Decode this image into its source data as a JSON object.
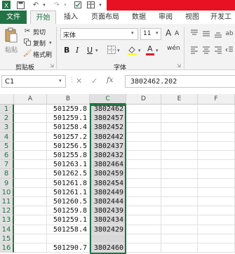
{
  "ribbon_tabs": {
    "file": "文件",
    "home": "开始",
    "insert": "插入",
    "page_layout": "页面布局",
    "data": "数据",
    "review": "审阅",
    "view": "视图",
    "developer": "开发工"
  },
  "clipboard": {
    "paste": "粘贴",
    "cut": "剪切",
    "copy": "复制",
    "format_painter": "格式刷",
    "group_label": "剪贴板"
  },
  "font": {
    "name": "宋体",
    "size": "11",
    "grow": "A",
    "shrink": "A",
    "bold": "B",
    "italic": "I",
    "underline": "U",
    "color_letter": "A",
    "group_label": "字体",
    "font_color": "#e81123",
    "highlight_color": "#ffff00"
  },
  "formula_bar": {
    "name_box": "C1",
    "fx": "fx",
    "value": "3802462.202"
  },
  "columns": [
    "A",
    "B",
    "C",
    "D",
    "E",
    "F"
  ],
  "selected_column": "C",
  "rows": [
    {
      "n": "1",
      "b": "501259.8",
      "c": "3802462"
    },
    {
      "n": "2",
      "b": "501259.1",
      "c": "3802457"
    },
    {
      "n": "3",
      "b": "501258.4",
      "c": "3802452"
    },
    {
      "n": "4",
      "b": "501257.2",
      "c": "3802442"
    },
    {
      "n": "5",
      "b": "501256.5",
      "c": "3802437"
    },
    {
      "n": "6",
      "b": "501255.8",
      "c": "3802432"
    },
    {
      "n": "7",
      "b": "501263.1",
      "c": "3802464"
    },
    {
      "n": "8",
      "b": "501262.5",
      "c": "3802459"
    },
    {
      "n": "9",
      "b": "501261.8",
      "c": "3802454"
    },
    {
      "n": "10",
      "b": "501261.1",
      "c": "3802449"
    },
    {
      "n": "11",
      "b": "501260.5",
      "c": "3802444"
    },
    {
      "n": "12",
      "b": "501259.8",
      "c": "3802439"
    },
    {
      "n": "13",
      "b": "501259.1",
      "c": "3802434"
    },
    {
      "n": "14",
      "b": "501258.4",
      "c": "3802429"
    },
    {
      "n": "15",
      "b": "",
      "c": ""
    },
    {
      "n": "16",
      "b": "501290.7",
      "c": "3802460"
    }
  ],
  "colors": {
    "accent": "#217346",
    "title_red": "#e81123",
    "selection": "#d8d8d8"
  }
}
